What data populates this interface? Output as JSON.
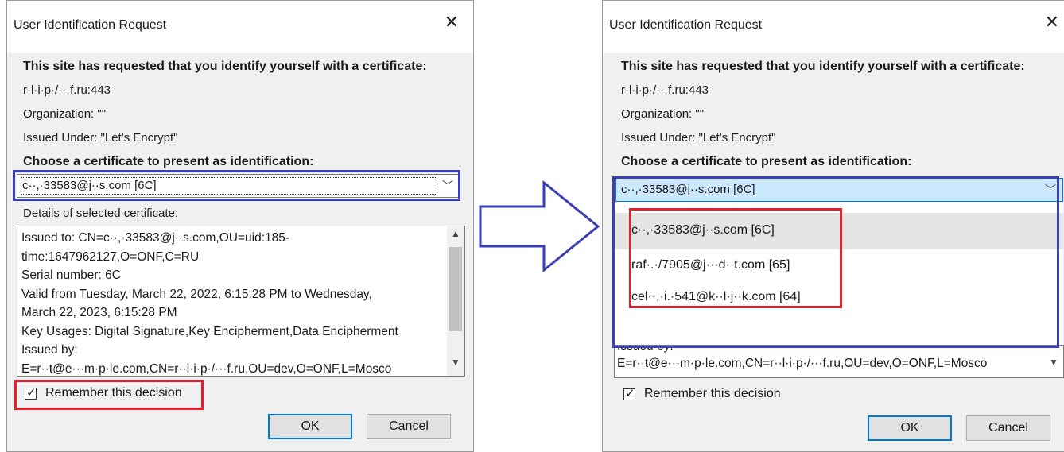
{
  "dialog": {
    "title": "User Identification Request",
    "close_icon": "close-icon",
    "heading": "This site has requested that you identify yourself with a certificate:",
    "site": "r·l·i·p·/···f.ru:443",
    "organization": "Organization: \"\"",
    "issuer": "Issued Under: \"Let's Encrypt\"",
    "choose_heading": "Choose a certificate to present as identification:",
    "selected_cert": "c··,·33583@j··s.com [6C]",
    "details_label": "Details of selected certificate:",
    "details_text": "Issued to: CN=c··,·33583@j··s.com,OU=uid:185-\ntime:1647962127,O=ONF,C=RU\nSerial number: 6C\nValid from Tuesday, March 22, 2022, 6:15:28 PM to Wednesday,\nMarch 22, 2023, 6:15:28 PM\nKey Usages: Digital Signature,Key Encipherment,Data Encipherment\nIssued by:\nE=r··t@e···m·p·le.com,CN=r··l·i·p·/···f.ru,OU=dev,O=ONF,L=Mosco",
    "details_bottom_partial": "Issued by:",
    "details_bottom_line": "E=r··t@e···m·p·le.com,CN=r··l·i·p·/···f.ru,OU=dev,O=ONF,L=Mosco",
    "remember_label": "Remember this decision",
    "ok_label": "OK",
    "cancel_label": "Cancel"
  },
  "dropdown": {
    "items": [
      "c··,·33583@j··s.com [6C]",
      "raf·.·/7905@j···d··t.com [65]",
      "cel··,·i.·541@k··l·j··k.com [64]"
    ]
  },
  "arrow_icon": "right-arrow-icon",
  "colors": {
    "annotation_blue": "#3a3fb8",
    "annotation_red": "#e0202a",
    "focus_blue": "#0078d7"
  }
}
